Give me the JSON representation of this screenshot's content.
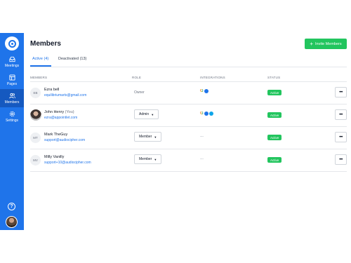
{
  "sidebar": {
    "logo_icon": "logo-icon",
    "items": [
      {
        "label": "Meetings",
        "icon": "inbox-icon"
      },
      {
        "label": "Pages",
        "icon": "layout-icon"
      },
      {
        "label": "Members",
        "icon": "users-icon",
        "active": true
      },
      {
        "label": "Settings",
        "icon": "gear-icon"
      }
    ],
    "help_label": "?"
  },
  "header": {
    "title": "Members",
    "invite_label": "Invite Members",
    "invite_plus": "+"
  },
  "tabs": [
    {
      "label": "Active (4)",
      "active": true
    },
    {
      "label": "Deactivated (13)",
      "active": false
    }
  ],
  "table": {
    "columns": [
      "MEMBERS",
      "ROLE",
      "INTEGRATIONS",
      "STATUS"
    ],
    "rows": [
      {
        "initials": "EB",
        "name": "Ezra bell",
        "you": "",
        "email": "equilibriumarts@gmail.com",
        "role": "Owner",
        "role_editable": false,
        "integrations": [
          "google",
          "zoom"
        ],
        "status": "Active",
        "more": "•••"
      },
      {
        "initials": "",
        "name": "John Henry",
        "you": "(You)",
        "email": "ezra@appointlet.com",
        "role": "Admin",
        "role_editable": true,
        "integrations": [
          "google",
          "zoom",
          "teams"
        ],
        "status": "Active",
        "more": "•••"
      },
      {
        "initials": "MT",
        "name": "Mark TheGuy",
        "you": "",
        "email": "support@audiocipher.com",
        "role": "Member",
        "role_editable": true,
        "integrations": [],
        "integrations_empty": "---",
        "status": "Active",
        "more": "•••"
      },
      {
        "initials": "MV",
        "name": "Milly Vanilly",
        "you": "",
        "email": "support+10@audiocipher.com",
        "role": "Member",
        "role_editable": true,
        "integrations": [],
        "integrations_empty": "---",
        "status": "Active",
        "more": "•••"
      }
    ]
  },
  "colors": {
    "sidebar": "#1f74ea",
    "accent": "#1f74ea",
    "success": "#22c55e"
  }
}
